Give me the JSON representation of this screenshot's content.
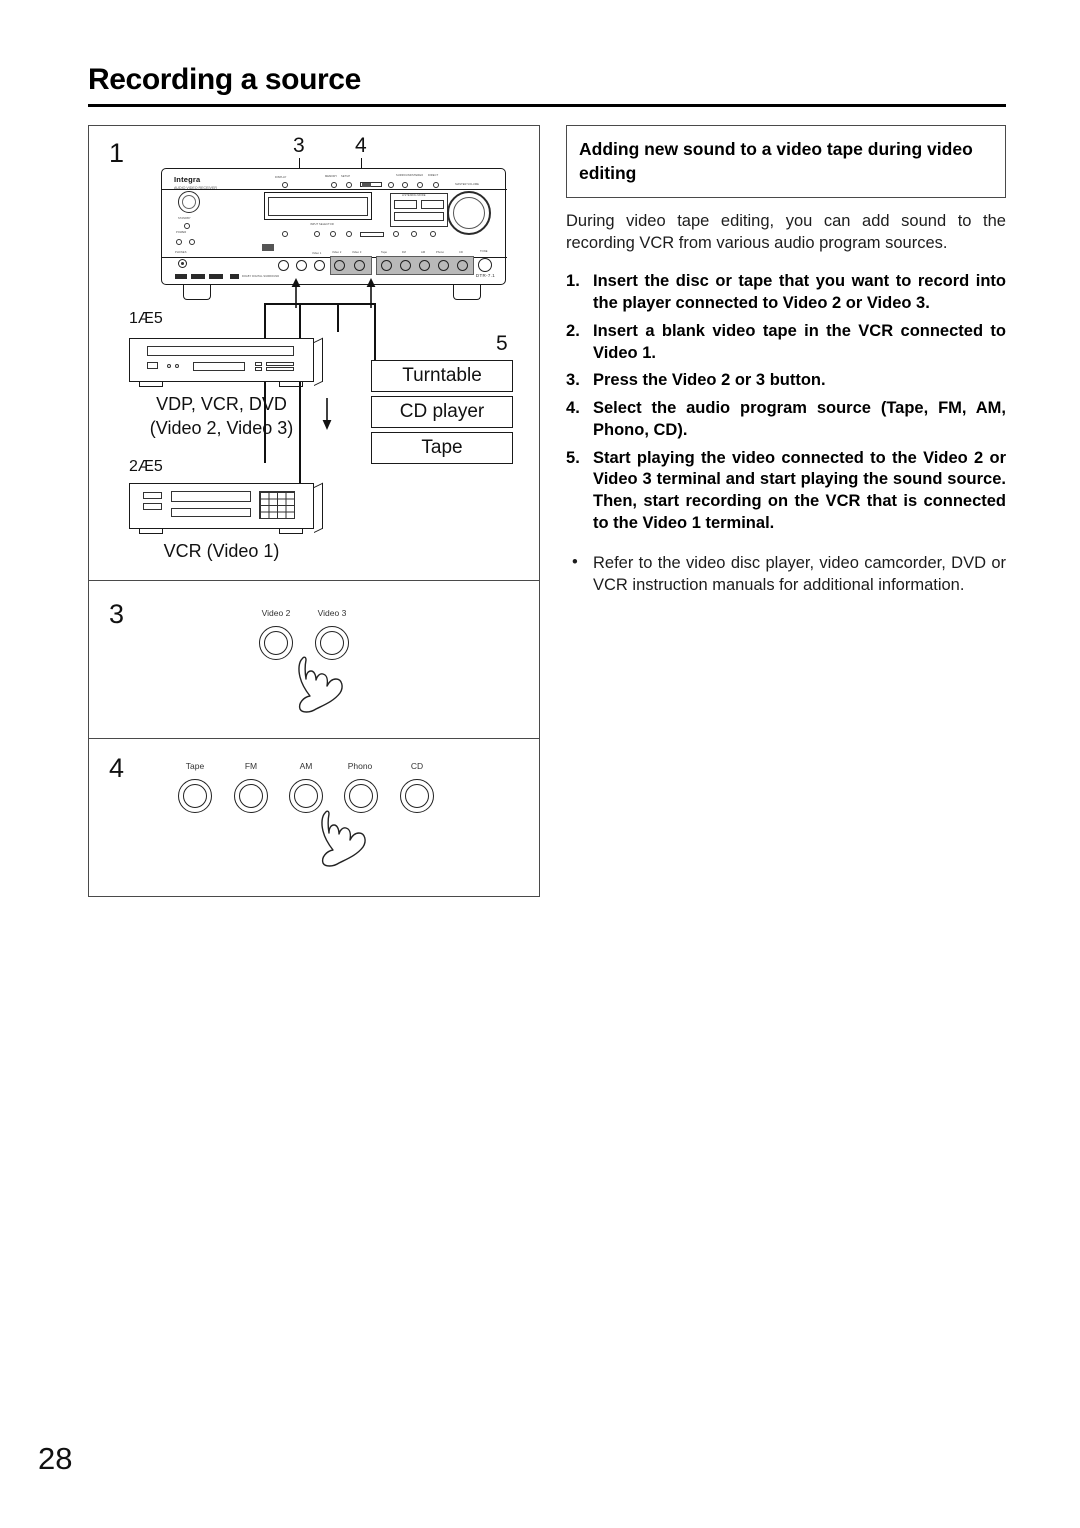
{
  "page": {
    "title": "Recording a source",
    "number": "28"
  },
  "diagram": {
    "panels": [
      {
        "step": "1"
      },
      {
        "step": "3"
      },
      {
        "step": "4"
      }
    ],
    "callouts": {
      "three": "3",
      "four": "4",
      "five": "5"
    },
    "receiver": {
      "brand": "Integra",
      "subbrand": "AUDIO VIDEO RECEIVER",
      "model": "DTR-7.1",
      "micro_labels": {
        "standby": "STANDBY",
        "power": "POWER",
        "phones": "PHONES",
        "listening_mode": "LISTENING MODE",
        "master_volume": "MASTER VOLUME",
        "input_selector": "INPUT SELECTOR",
        "video1": "Video 1",
        "video2": "Video 2",
        "video3": "Video 3",
        "tape": "Tape",
        "fm": "FM",
        "am": "AM",
        "phono": "Phono",
        "cd": "CD",
        "tone": "TONE",
        "balance": "BALANCE",
        "display": "DISPLAY",
        "memory": "MEMORY",
        "setup": "SETUP",
        "surround": "SURROUND",
        "stereo": "STEREO",
        "direct": "DIRECT"
      }
    },
    "devices": [
      {
        "name": "vdp-device",
        "arrow_label": "1Æ5",
        "caption_line1": "VDP, VCR, DVD",
        "caption_line2": "(Video 2, Video 3)"
      },
      {
        "name": "vcr-device",
        "arrow_label": "2Æ5",
        "caption_line1": "VCR (Video 1)",
        "caption_line2": ""
      }
    ],
    "sources": [
      "Turntable",
      "CD player",
      "Tape"
    ],
    "video_buttons": [
      "Video 2",
      "Video 3"
    ],
    "audio_buttons": [
      "Tape",
      "FM",
      "AM",
      "Phono",
      "CD"
    ]
  },
  "instructions": {
    "heading": "Adding new sound to a video tape during video editing",
    "intro": "During video tape editing, you can add sound to the recording VCR from various audio program sources.",
    "steps": [
      "Insert the disc or tape that you want to record into the player connected to Video 2 or Video 3.",
      "Insert a blank video tape in the VCR connected to Video 1.",
      "Press the Video 2 or 3 button.",
      "Select the audio program source (Tape, FM, AM, Phono, CD).",
      "Start playing the video connected to the Video 2 or Video 3 terminal and start playing the sound source. Then, start recording on the VCR that is connected to the Video 1 terminal."
    ],
    "notes": [
      "Refer to the video disc player, video camcorder, DVD or VCR instruction manuals for additional information."
    ]
  }
}
